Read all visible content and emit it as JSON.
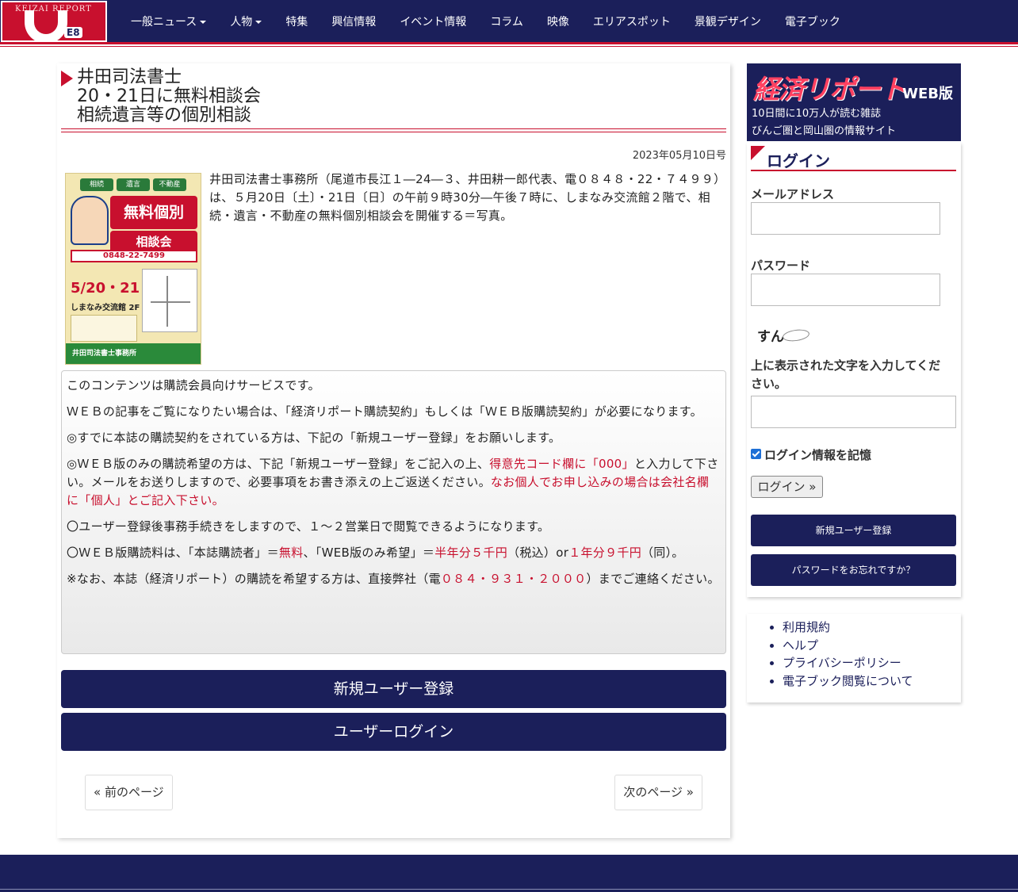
{
  "logo": {
    "top_text": "KEIZAI REPORT",
    "sub_text": "E8"
  },
  "nav": {
    "items": [
      {
        "label": "一般ニュース",
        "dropdown": true
      },
      {
        "label": "人物",
        "dropdown": true
      },
      {
        "label": "特集"
      },
      {
        "label": "興信情報"
      },
      {
        "label": "イベント情報"
      },
      {
        "label": "コラム"
      },
      {
        "label": "映像"
      },
      {
        "label": "エリアスポット"
      },
      {
        "label": "景観デザイン"
      },
      {
        "label": "電子ブック"
      }
    ]
  },
  "article": {
    "title_lines": [
      "井田司法書士",
      "20・21日に無料相談会",
      "相続遺言等の個別相談"
    ],
    "date": "2023年05月10日号",
    "lead": "井田司法書士事務所（尾道市長江１―24―３、井田耕一郎代表、電０８４８・22・７４９９）は、５月20日〔土〕・21日〔日〕の午前９時30分―午後７時に、しまなみ交流館２階で、相続・遺言・不動産の無料個別相談会を開催する＝写真。",
    "flyer": {
      "tags": [
        "相続",
        "遺言",
        "不動産"
      ],
      "headline": "無料個別",
      "headline2": "相談会",
      "phone": "0848-22-7499",
      "dates": "5/20・21",
      "venue": "しまなみ交流館 2F",
      "footer": "井田司法書士事務所"
    }
  },
  "member_notice": {
    "p1": "このコンテンツは購読会員向けサービスです。",
    "p2": "ＷＥＢの記事をご覧になりたい場合は、「経済リポート購読契約」もしくは「ＷＥＢ版購読契約」が必要になります。",
    "p3": "◎すでに本誌の購読契約をされている方は、下記の「新規ユーザー登録」をお願いします。",
    "p4a": "◎ＷＥＢ版のみの購読希望の方は、下記「新規ユーザー登録」をご記入の上、",
    "p4b": "得意先コード欄に「000」",
    "p4c": "と入力して下さい。メールをお送りしますので、必要事項をお書き添えの上ご返送ください。",
    "p4d": "なお個人でお申し込みの場合は会社名欄に「個人」とご記入下さい。",
    "p5": "〇ユーザー登録後事務手続きをしますので、１～２営業日で閲覧できるようになります。",
    "p6a": "〇ＷＥＢ版購読料は、「本誌購読者」＝",
    "p6b": "無料",
    "p6c": "、「WEB版のみ希望」＝",
    "p6d": "半年分５千円",
    "p6e": "（税込）or",
    "p6f": "１年分９千円",
    "p6g": "（同）。",
    "p7a": "※なお、本誌（経済リポート）の購読を希望する方は、直接弊社（電",
    "p7b": "０８４・９３１・２０００",
    "p7c": "）までご連絡ください。"
  },
  "buttons": {
    "register": "新規ユーザー登録",
    "user_login": "ユーザーログイン",
    "prev": "« 前のページ",
    "next": "次のページ »"
  },
  "sidebar": {
    "banner": {
      "brand": "経済リポート",
      "edition": "WEB版",
      "tagline1": "10日間に10万人が読む雑誌",
      "tagline2": "びんご圏と岡山圏の情報サイト"
    },
    "login": {
      "heading": "ログイン",
      "email_label": "メールアドレス",
      "password_label": "パスワード",
      "captcha_text": "すん",
      "captcha_label": "上に表示された文字を入力してください。",
      "remember_label": "ログイン情報を記憶",
      "login_button": "ログイン »",
      "register_button": "新規ユーザー登録",
      "forgot_button": "パスワードをお忘れですか？"
    },
    "links": [
      "利用規約",
      "ヘルプ",
      "プライバシーポリシー",
      "電子ブック閲覧について"
    ]
  },
  "colors": {
    "navy": "#1b1f5a",
    "accent_red": "#c8102e"
  }
}
